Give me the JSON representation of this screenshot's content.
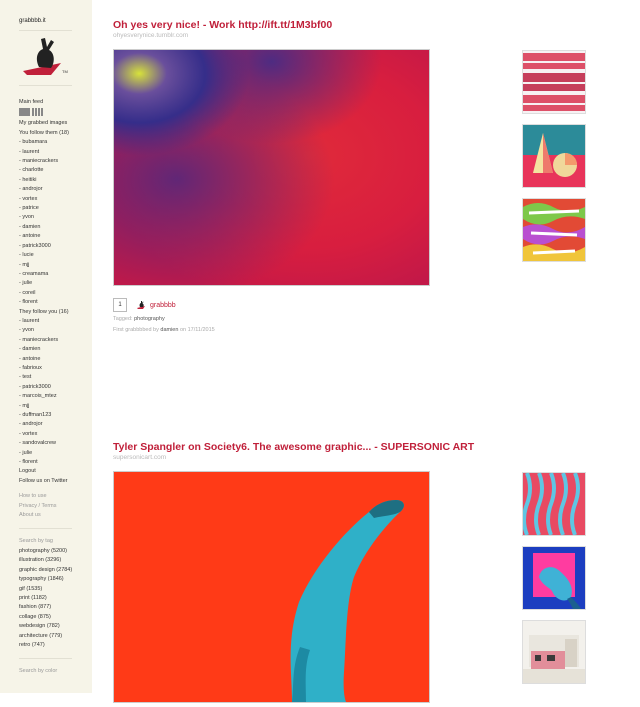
{
  "site": {
    "name": "grabbbb.it"
  },
  "sidebar": {
    "main_feed": "Main feed",
    "my_grabbed": "My grabbed images",
    "follow_header": "You follow them (18)",
    "following": [
      "- bubamara",
      "- laurent",
      "- maniecrackers",
      "- charlotte",
      "- heitiki",
      "- androjor",
      "- vortex",
      "- patrice",
      "- yvon",
      "- damien",
      "- antoine",
      "- patrick3000",
      "- lucie",
      "- mjj",
      "- creamama",
      "- julie",
      "- coreil",
      "- florent"
    ],
    "followers_header": "They follow you (16)",
    "followers": [
      "- laurent",
      "- yvon",
      "- maniecrackers",
      "- damien",
      "- antoine",
      "- fabrioux",
      "- test",
      "- patrick3000",
      "- marcois_mtez",
      "- mjj",
      "- duffman123",
      "- androjor",
      "- vortex",
      "- sandovalcrew",
      "- julie",
      "- florent"
    ],
    "logout": "Logout",
    "twitter": "Follow us on Twitter",
    "help_links": [
      "How to use",
      "Privacy / Terms",
      "About us"
    ],
    "search_tag_header": "Search by tag",
    "tags": [
      "photography (5200)",
      "illustration (3296)",
      "graphic design (2784)",
      "typography (1846)",
      "gif (1535)",
      "print (1182)",
      "fashion (877)",
      "collage (875)",
      "webdesign (782)",
      "architecture (779)",
      "retro (747)"
    ],
    "search_color_header": "Search by color"
  },
  "posts": [
    {
      "title": "Oh yes very nice! - Work http://ift.tt/1M3bf00",
      "source": "ohyesverynice.tumblr.com",
      "count": "1",
      "grabber": "grabbbb",
      "tagged_label": "Tagged:",
      "tag": "photography",
      "first_prefix": "First grabbbbed by",
      "first_user": "damien",
      "first_on": "on 17/11/2015"
    },
    {
      "title": "Tyler Spangler on Society6. The awesome graphic... - SUPERSONIC ART",
      "source": "supersonicart.com"
    }
  ],
  "colors": {
    "accent": "#c0203a",
    "sidebar_bg": "#f6f4e8"
  }
}
